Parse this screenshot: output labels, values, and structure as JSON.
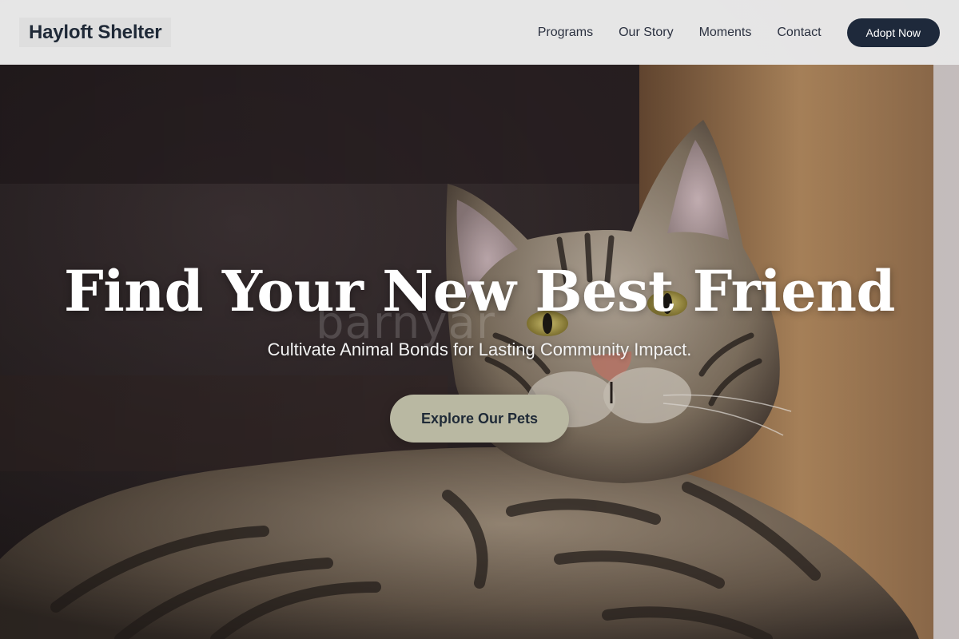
{
  "header": {
    "brand": "Hayloft Shelter",
    "nav": [
      {
        "label": "Programs"
      },
      {
        "label": "Our Story"
      },
      {
        "label": "Moments"
      },
      {
        "label": "Contact"
      }
    ],
    "cta_label": "Adopt Now"
  },
  "hero": {
    "title": "Find Your New Best Friend",
    "subtitle": "Cultivate Animal Bonds for Lasting Community Impact.",
    "button_label": "Explore Our Pets",
    "watermark": "barnyar"
  },
  "colors": {
    "header_bg": "#ececec",
    "brand_text": "#1f2937",
    "cta_bg": "#1e293b",
    "explore_bg": "#b9b8a2",
    "explore_text": "#1f2a37"
  }
}
